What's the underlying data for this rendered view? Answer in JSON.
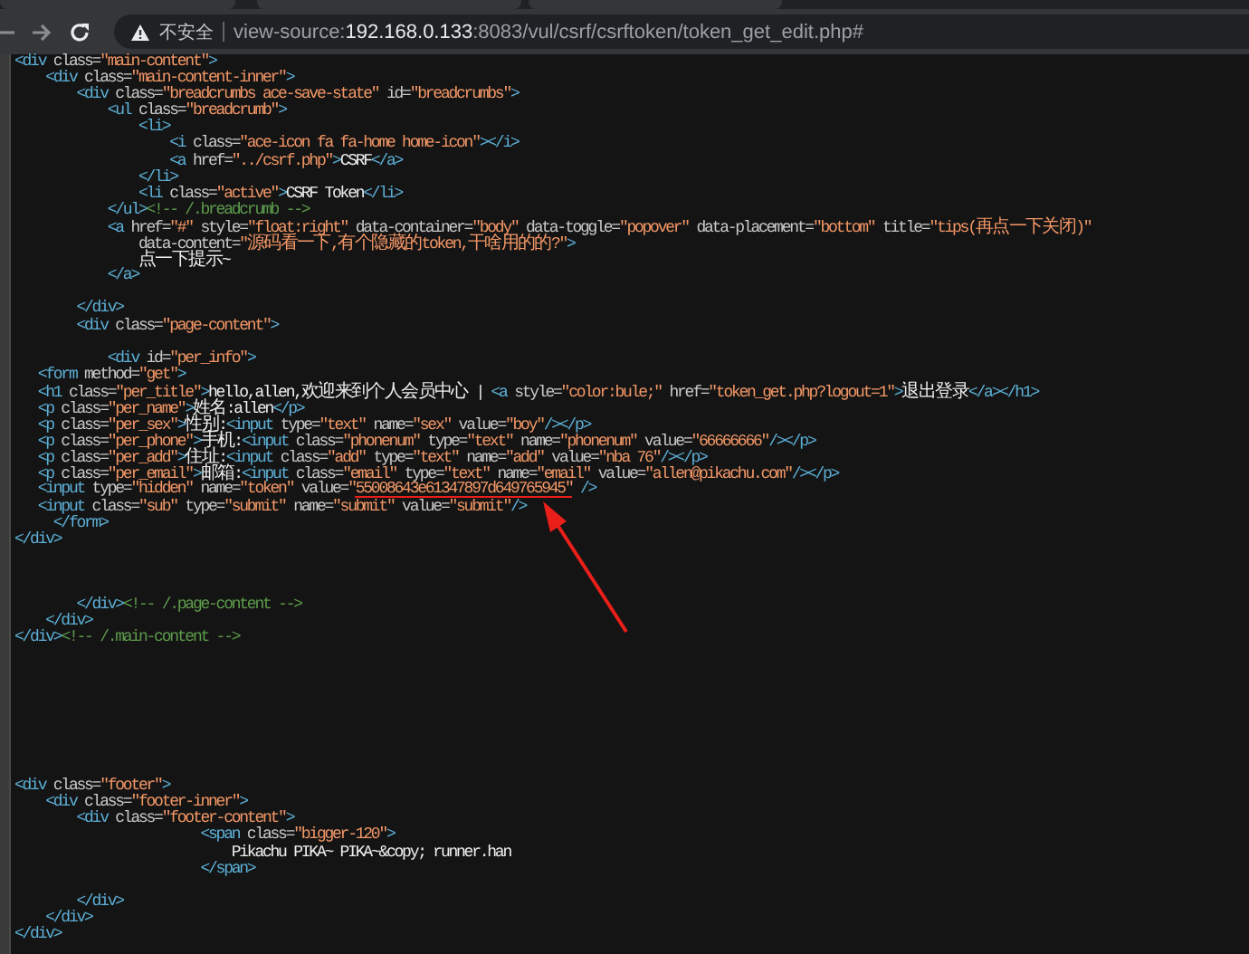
{
  "browser": {
    "security_label": "不安全",
    "url_scheme": "view-source:",
    "url_host": "192.168.0.133",
    "url_path": ":8083/vul/csrf/csrftoken/token_get_edit.php#"
  },
  "source_lines": [
    {
      "kind": "code",
      "text": "<div class=\"main-content\">"
    },
    {
      "kind": "code",
      "text": "    <div class=\"main-content-inner\">"
    },
    {
      "kind": "code",
      "text": "        <div class=\"breadcrumbs ace-save-state\" id=\"breadcrumbs\">"
    },
    {
      "kind": "code",
      "text": "            <ul class=\"breadcrumb\">"
    },
    {
      "kind": "code",
      "text": "                <li>"
    },
    {
      "kind": "code",
      "text": "                    <i class=\"ace-icon fa fa-home home-icon\"></i>"
    },
    {
      "kind": "code",
      "text": "                    <a href=\"../csrf.php\">CSRF</a>"
    },
    {
      "kind": "code",
      "text": "                </li>"
    },
    {
      "kind": "code",
      "text": "                <li class=\"active\">CSRF Token</li>"
    },
    {
      "kind": "code",
      "text": "            </ul><!-- /.breadcrumb -->"
    },
    {
      "kind": "code",
      "text": "            <a href=\"#\" style=\"float:right\" data-container=\"body\" data-toggle=\"popover\" data-placement=\"bottom\" title=\"tips(再点一下关闭)\""
    },
    {
      "kind": "code",
      "text": "                data-content=\"源码看一下,有个隐藏的token,干啥用的的?\">"
    },
    {
      "kind": "code",
      "text": "                点一下提示~"
    },
    {
      "kind": "code",
      "text": "            </a>"
    },
    {
      "kind": "blank"
    },
    {
      "kind": "code",
      "text": "        </div>"
    },
    {
      "kind": "code",
      "text": "        <div class=\"page-content\">"
    },
    {
      "kind": "blank"
    },
    {
      "kind": "code",
      "text": "            <div id=\"per_info\">"
    },
    {
      "kind": "code",
      "text": "   <form method=\"get\">"
    },
    {
      "kind": "code",
      "text": "   <h1 class=\"per_title\">hello,allen,欢迎来到个人会员中心 | <a style=\"color:bule;\" href=\"token_get.php?logout=1\">退出登录</a></h1>"
    },
    {
      "kind": "code",
      "text": "   <p class=\"per_name\">姓名:allen</p>"
    },
    {
      "kind": "code",
      "text": "   <p class=\"per_sex\">性别:<input type=\"text\" name=\"sex\" value=\"boy\"/></p>"
    },
    {
      "kind": "code",
      "text": "   <p class=\"per_phone\">手机:<input class=\"phonenum\" type=\"text\" name=\"phonenum\" value=\"66666666\"/></p>"
    },
    {
      "kind": "code",
      "text": "   <p class=\"per_add\">住址:<input class=\"add\" type=\"text\" name=\"add\" value=\"nba 76\"/></p>"
    },
    {
      "kind": "code",
      "text": "   <p class=\"per_email\">邮箱:<input class=\"email\" type=\"text\" name=\"email\" value=\"allen@pikachu.com\"/></p>"
    },
    {
      "kind": "code",
      "text": "   <input type=\"hidden\" name=\"token\" value=\"",
      "underlined_text": "55008643e61347897d649765945\"",
      "text_after": " />"
    },
    {
      "kind": "code",
      "text": "   <input class=\"sub\" type=\"submit\" name=\"submit\" value=\"submit\"/>"
    },
    {
      "kind": "code",
      "text": "     </form>"
    },
    {
      "kind": "code",
      "text": "</div>"
    },
    {
      "kind": "blank"
    },
    {
      "kind": "blank"
    },
    {
      "kind": "blank"
    },
    {
      "kind": "code",
      "text": "        </div><!-- /.page-content -->"
    },
    {
      "kind": "code",
      "text": "    </div>"
    },
    {
      "kind": "code",
      "text": "</div><!-- /.main-content -->"
    },
    {
      "kind": "blank"
    },
    {
      "kind": "blank"
    },
    {
      "kind": "blank"
    },
    {
      "kind": "blank"
    },
    {
      "kind": "blank"
    },
    {
      "kind": "blank"
    },
    {
      "kind": "blank"
    },
    {
      "kind": "blank"
    },
    {
      "kind": "code",
      "text": "<div class=\"footer\">"
    },
    {
      "kind": "code",
      "text": "    <div class=\"footer-inner\">"
    },
    {
      "kind": "code",
      "text": "        <div class=\"footer-content\">"
    },
    {
      "kind": "code",
      "text": "                        <span class=\"bigger-120\">"
    },
    {
      "kind": "code",
      "text": "                            Pikachu PIKA~ PIKA~&copy; runner.han"
    },
    {
      "kind": "code",
      "text": "                        </span>"
    },
    {
      "kind": "blank"
    },
    {
      "kind": "code",
      "text": "        </div>"
    },
    {
      "kind": "code",
      "text": "    </div>"
    },
    {
      "kind": "code",
      "text": "</div>"
    }
  ],
  "annotation_arrow": true
}
